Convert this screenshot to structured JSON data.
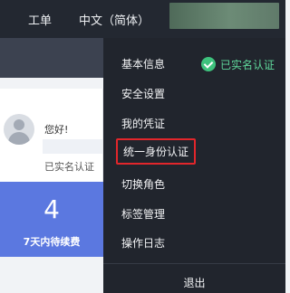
{
  "header": {
    "ticket": "工单",
    "language": "中文（简体）"
  },
  "profile": {
    "greeting": "您好!",
    "verified_status": "已实名认证"
  },
  "stat": {
    "value": "4",
    "label": "7天内待续费"
  },
  "dropdown": {
    "badge": "已实名认证",
    "items": [
      {
        "label": "基本信息"
      },
      {
        "label": "安全设置"
      },
      {
        "label": "我的凭证"
      },
      {
        "label": "统一身份认证"
      },
      {
        "label": "切换角色"
      },
      {
        "label": "标签管理"
      },
      {
        "label": "操作日志"
      }
    ],
    "logout": "退出"
  },
  "colors": {
    "header_bg": "#232831",
    "dropdown_bg": "#21252d",
    "accent_blue": "#5b78e0",
    "verified_green": "#3ec27d",
    "highlight_red": "#e2262b"
  }
}
